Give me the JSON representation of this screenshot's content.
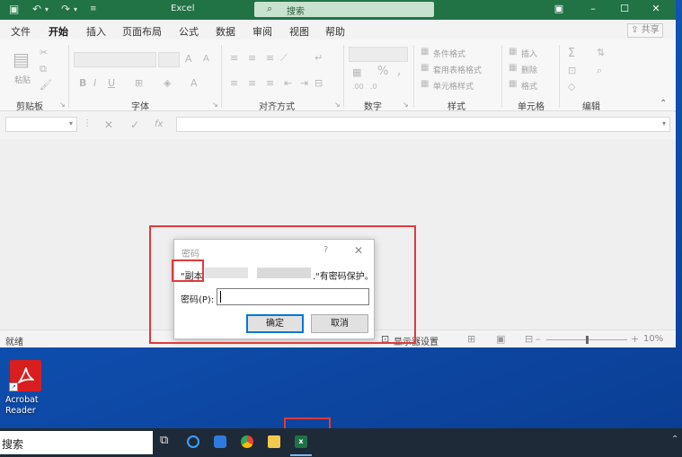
{
  "excel": {
    "app_title": "Excel",
    "search_placeholder": "搜索",
    "tabs": [
      "文件",
      "开始",
      "插入",
      "页面布局",
      "公式",
      "数据",
      "审阅",
      "视图",
      "帮助"
    ],
    "share_label": "共享",
    "ribbon": {
      "paste_label": "粘贴",
      "groups": [
        "剪贴板",
        "字体",
        "对齐方式",
        "数字",
        "样式",
        "单元格",
        "编辑"
      ],
      "font_size_up": "A",
      "bold": "B",
      "italic": "I",
      "underline": "U",
      "percent": "%",
      "styles": [
        "条件格式",
        "套用表格格式",
        "单元格样式"
      ],
      "cells": [
        "插入",
        "删除",
        "格式"
      ]
    },
    "formula": {
      "cancel_glyph": "✕",
      "enter_glyph": "✓",
      "fx_glyph": "fx"
    },
    "status": {
      "ready": "就绪",
      "display_settings": "显示器设置",
      "zoom": "10%"
    }
  },
  "dialog": {
    "title": "密码",
    "help": "?",
    "close": "✕",
    "message_prefix": "\"副本",
    "message_suffix": ".\"有密码保护。",
    "password_label": "密码(P):",
    "ok_label": "确定",
    "cancel_label": "取消"
  },
  "desktop": {
    "acrobat_label": "Acrobat Reader"
  },
  "taskbar": {
    "search_label": "搜索"
  },
  "colors": {
    "excel_green": "#217346",
    "annotation_red": "#e03a3a",
    "desktop_blue": "#1a66c8",
    "taskbar": "#1f2a38"
  }
}
